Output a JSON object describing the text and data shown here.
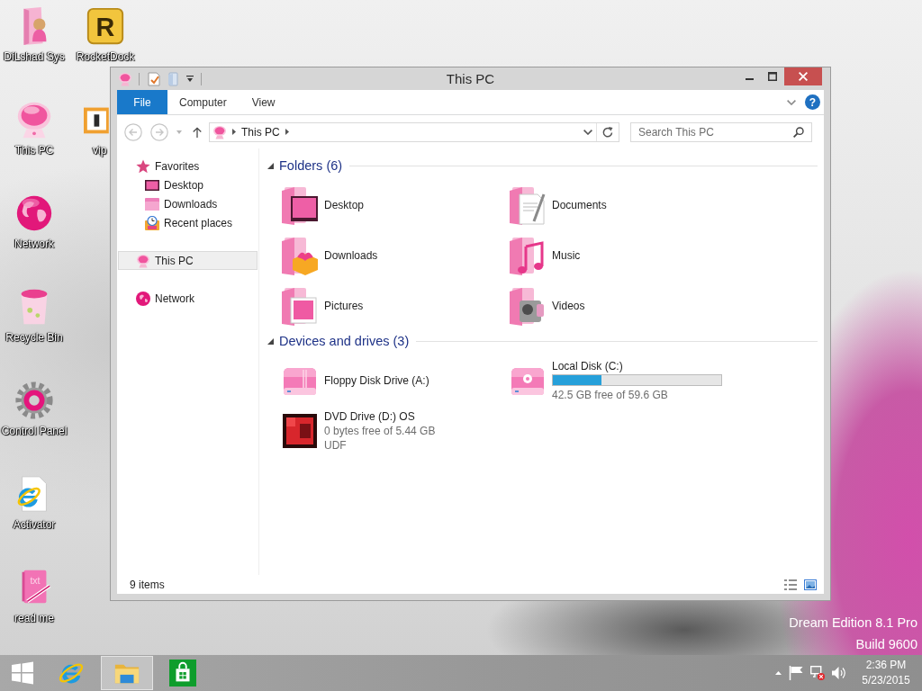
{
  "desktop_icons": [
    {
      "label": "DiLshad Sys"
    },
    {
      "label": "This PC"
    },
    {
      "label": "Network"
    },
    {
      "label": "Recycle Bin"
    },
    {
      "label": "Control Panel"
    },
    {
      "label": "Activator"
    },
    {
      "label": "read me",
      "icon_text": "txt"
    },
    {
      "label": "RocketDock",
      "icon_text": "R"
    },
    {
      "label": "vip"
    }
  ],
  "window": {
    "title": "This PC",
    "ribbon_tabs": [
      {
        "label": "File",
        "kind": "menu"
      },
      {
        "label": "Computer",
        "kind": "tab"
      },
      {
        "label": "View",
        "kind": "tab"
      }
    ],
    "help_glyph": "?",
    "history_buttons": [
      {
        "disabled": true
      },
      {
        "disabled": true
      }
    ],
    "address_bar": {
      "path": [
        "This PC"
      ]
    },
    "search": {
      "placeholder": "Search This PC"
    },
    "navigation": [
      {
        "label": "Favorites",
        "selected": false,
        "children": [
          {
            "label": "Desktop",
            "selected": false
          },
          {
            "label": "Downloads",
            "selected": false
          },
          {
            "label": "Recent places",
            "selected": false
          }
        ]
      },
      {
        "label": "This PC",
        "selected": true
      },
      {
        "label": "Network",
        "selected": false
      }
    ],
    "content": {
      "folders": {
        "heading": "Folders (6)",
        "expanded": true,
        "items": [
          {
            "label": "Desktop"
          },
          {
            "label": "Documents"
          },
          {
            "label": "Downloads"
          },
          {
            "label": "Music"
          },
          {
            "label": "Pictures"
          },
          {
            "label": "Videos"
          }
        ]
      },
      "devices": {
        "heading": "Devices and drives (3)",
        "expanded": true,
        "items": [
          {
            "name": "Floppy Disk Drive (A:)"
          },
          {
            "name": "Local Disk (C:)",
            "level": 0.287,
            "details": [
              "42.5 GB free of 59.6 GB"
            ]
          },
          {
            "name": "DVD Drive (D:) OS",
            "details": [
              "0 bytes free of 5.44 GB",
              "UDF"
            ]
          }
        ]
      }
    },
    "status_bar": {
      "item_count": "9 items"
    }
  },
  "desktop_version_text": [
    "Dream Edition 8.1 Pro",
    "Build 9600"
  ],
  "taskbar": {
    "apps": [
      {
        "selected": false
      },
      {
        "selected": true
      },
      {
        "selected": false
      }
    ],
    "clock": {
      "time": "2:36 PM",
      "date": "5/23/2015"
    }
  }
}
